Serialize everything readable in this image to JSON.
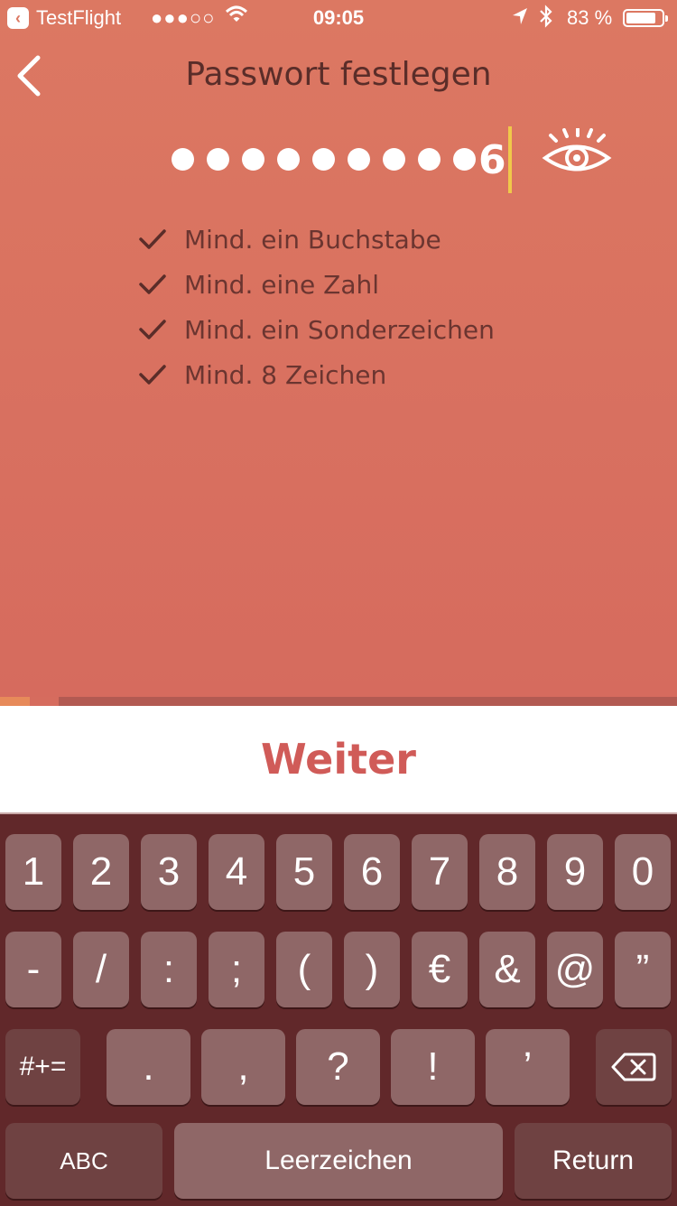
{
  "status_bar": {
    "back_app": "TestFlight",
    "signal": "●●●○○",
    "time": "09:05",
    "battery_percent": "83 %",
    "battery_level": 0.83
  },
  "header": {
    "title": "Passwort festlegen"
  },
  "password": {
    "masked_count": 9,
    "last_char": "6"
  },
  "rules": [
    {
      "label": "Mind. ein Buchstabe",
      "met": true
    },
    {
      "label": "Mind. eine Zahl",
      "met": true
    },
    {
      "label": "Mind. ein Sonderzeichen",
      "met": true
    },
    {
      "label": "Mind. 8 Zeichen",
      "met": true
    }
  ],
  "action": {
    "weiter_label": "Weiter"
  },
  "keyboard": {
    "row1": [
      "1",
      "2",
      "3",
      "4",
      "5",
      "6",
      "7",
      "8",
      "9",
      "0"
    ],
    "row2": [
      "-",
      "/",
      ":",
      ";",
      "(",
      ")",
      "€",
      "&",
      "@",
      "”"
    ],
    "row3_mode": "#+=",
    "row3": [
      ".",
      ",",
      "?",
      "!",
      "’"
    ],
    "abc_label": "ABC",
    "space_label": "Leerzeichen",
    "return_label": "Return"
  },
  "colors": {
    "background": "#d66c5e",
    "title_text": "#5a2d29",
    "accent_button": "#d05b58",
    "caret": "#f0c84a",
    "keyboard_bg": "#61282a"
  }
}
